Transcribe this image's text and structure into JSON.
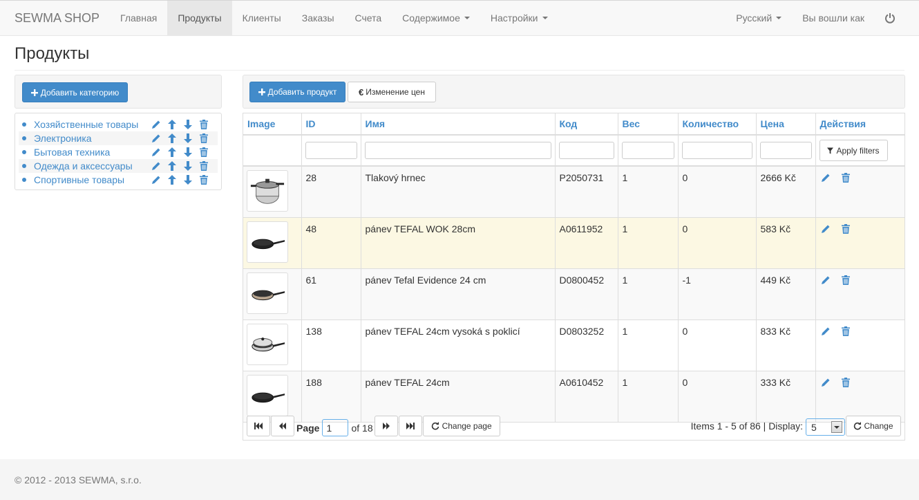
{
  "navbar": {
    "brand": "SEWMA SHOP",
    "items": [
      {
        "label": "Главная",
        "active": false
      },
      {
        "label": "Продукты",
        "active": true
      },
      {
        "label": "Клиенты",
        "active": false
      },
      {
        "label": "Заказы",
        "active": false
      },
      {
        "label": "Счета",
        "active": false
      },
      {
        "label": "Содержимое",
        "active": false,
        "dropdown": true
      },
      {
        "label": "Настройки",
        "active": false,
        "dropdown": true
      }
    ],
    "language": "Русский",
    "logged_in": "Вы вошли как"
  },
  "page": {
    "title": "Продукты"
  },
  "categories": {
    "add_button": "Добавить категорию",
    "items": [
      {
        "label": "Хозяйственные товары"
      },
      {
        "label": "Электроника"
      },
      {
        "label": "Бытовая техника"
      },
      {
        "label": "Одежда и аксессуары"
      },
      {
        "label": "Спортивные товары"
      }
    ]
  },
  "products": {
    "add_button": "Добавить продукт",
    "price_change_button": "Изменение цен",
    "columns": {
      "image": "Image",
      "id": "ID",
      "name": "Имя",
      "code": "Код",
      "weight": "Вес",
      "quantity": "Количество",
      "price": "Цена",
      "actions": "Действия"
    },
    "apply_filters": "Apply filters",
    "rows": [
      {
        "id": "28",
        "name": "Tlakový hrnec",
        "code": "P2050731",
        "weight": "1",
        "quantity": "0",
        "price": "2666 Kč"
      },
      {
        "id": "48",
        "name": "pánev TEFAL WOK 28cm",
        "code": "A0611952",
        "weight": "1",
        "quantity": "0",
        "price": "583 Kč"
      },
      {
        "id": "61",
        "name": "pánev Tefal Evidence 24 cm",
        "code": "D0800452",
        "weight": "1",
        "quantity": "-1",
        "price": "449 Kč"
      },
      {
        "id": "138",
        "name": "pánev TEFAL 24cm vysoká s poklicí",
        "code": "D0803252",
        "weight": "1",
        "quantity": "0",
        "price": "833 Kč"
      },
      {
        "id": "188",
        "name": "pánev TEFAL 24cm",
        "code": "A0610452",
        "weight": "1",
        "quantity": "0",
        "price": "333 Kč"
      }
    ]
  },
  "pager": {
    "page_label": "Page",
    "page_value": "1",
    "of_label": "of 18",
    "change_page": "Change page",
    "items_info": "Items 1 - 5 of 86 | Display:",
    "display_value": "5",
    "change": "Change"
  },
  "footer": {
    "text": "© 2012 - 2013 SEWMA, s.r.o."
  },
  "colors": {
    "accent": "#428bca",
    "hover_row": "#fcf8e3",
    "navbar": "#f8f8f8"
  }
}
